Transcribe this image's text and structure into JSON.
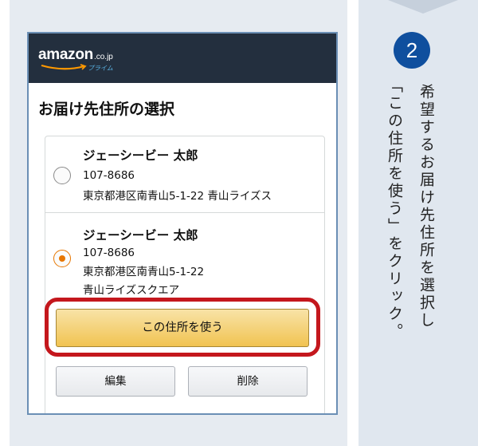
{
  "header": {
    "logo_word": "amazon",
    "logo_domain": ".co.jp",
    "logo_sub": "プライム"
  },
  "page": {
    "title": "お届け先住所の選択"
  },
  "addresses": [
    {
      "name": "ジェーシービー 太郎",
      "postal": "107-8686",
      "line1": "東京都港区南青山5-1-22 青山ライズス",
      "line2": "",
      "selected": false
    },
    {
      "name": "ジェーシービー 太郎",
      "postal": "107-8686",
      "line1": "東京都港区南青山5-1-22",
      "line2": "青山ライズスクエア",
      "selected": true
    }
  ],
  "buttons": {
    "use_address": "この住所を使う",
    "edit": "編集",
    "delete": "削除"
  },
  "instruction": {
    "step_number": "2",
    "line1": "希望するお届け先住所を選択し",
    "line2": "「この住所を使う」をクリック。"
  },
  "colors": {
    "header_bg": "#232f3e",
    "highlight": "#c4171d",
    "step_circle": "#0f4f9e",
    "radio_selected": "#e77600",
    "use_button": "#f1c351"
  }
}
